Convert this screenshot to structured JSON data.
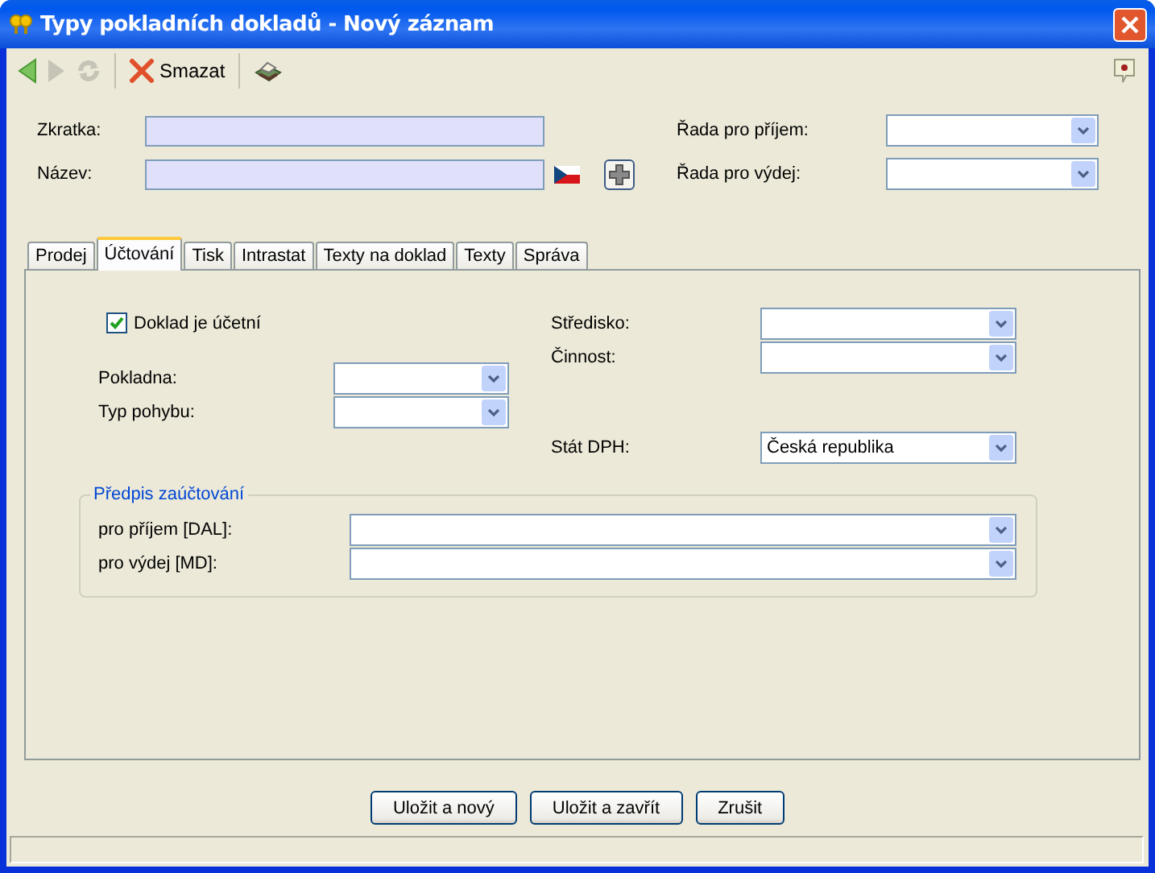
{
  "window": {
    "title": "Typy pokladních dokladů - Nový záznam"
  },
  "toolbar": {
    "items": [
      {
        "kind": "back"
      },
      {
        "kind": "forward",
        "disabled": true
      },
      {
        "kind": "refresh",
        "disabled": true
      },
      {
        "kind": "delete",
        "label": "Smazat"
      },
      {
        "kind": "print"
      }
    ]
  },
  "header": {
    "zkratka": {
      "label": "Zkratka:"
    },
    "nazev": {
      "label": "Název:"
    },
    "rada_prijem": {
      "label": "Řada pro příjem:"
    },
    "rada_vydej": {
      "label": "Řada pro výdej:"
    }
  },
  "tabs": [
    {
      "label": "Prodej",
      "selected": false
    },
    {
      "label": "Účtování",
      "selected": true
    },
    {
      "label": "Tisk",
      "selected": false
    },
    {
      "label": "Intrastat",
      "selected": false
    },
    {
      "label": "Texty na doklad",
      "selected": false
    },
    {
      "label": "Texty",
      "selected": false
    },
    {
      "label": "Správa",
      "selected": false
    }
  ],
  "panel": {
    "checkbox": {
      "label": "Doklad je účetní",
      "checked": true
    },
    "left_fields": [
      {
        "label": "Pokladna:"
      },
      {
        "label": "Typ pohybu:"
      }
    ],
    "right_fields": [
      {
        "label": "Středisko:"
      },
      {
        "label": "Činnost:"
      },
      {
        "label": "Stát DPH:",
        "value": "Česká republika"
      }
    ],
    "group": {
      "title": "Předpis zaúčtování",
      "fields": [
        {
          "label": "pro příjem [DAL]:"
        },
        {
          "label": "pro výdej [MD]:"
        }
      ]
    }
  },
  "buttons": [
    {
      "label": "Uložit a nový"
    },
    {
      "label": "Uložit a zavřít"
    },
    {
      "label": "Zrušit"
    }
  ]
}
